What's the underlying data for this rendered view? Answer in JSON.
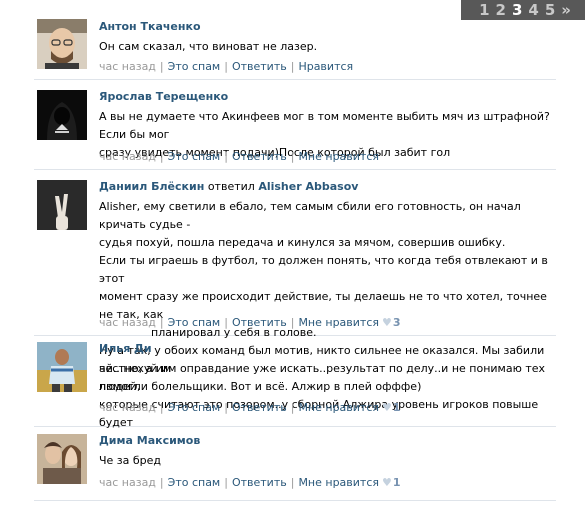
{
  "pager": {
    "pages": [
      "1",
      "2",
      "3",
      "4",
      "5"
    ],
    "current": "3",
    "next": "»"
  },
  "comments": [
    {
      "author": "Антон Ткаченко",
      "lines": [
        "Он сам сказал, что виноват не лазер."
      ],
      "time": "час назад",
      "spam": "Это спам",
      "reply": "Ответить",
      "like": "Нравится"
    },
    {
      "author": "Ярослав Терещенко",
      "lines": [
        "А вы не думаете что Акинфеев мог в том моменте выбить мяч из штрафной?Если бы мог",
        "сразу увидеть момент подачи)После которой был забит гол"
      ],
      "time": "час назад",
      "spam": "Это спам",
      "reply": "Ответить",
      "like": "Мне нравится"
    },
    {
      "author": "Даниил Блёскин",
      "reply_word": "ответил",
      "reply_to": "Alisher Abbasov",
      "lines": [
        "Alisher, ему светили в ебало, тем самым сбили его готовность, он начал кричать судье -",
        "судья похуй, пошла передача и кинулся за мячом, совершив ошибку.",
        "Если ты играешь в футбол, то должен понять, что когда тебя отвлекают и в этот",
        "момент сразу же происходит действие, ты делаешь не то что хотел, точнее не так, как",
        "планировал у себя в голове.",
        "Ну а так, у обоих команд был мотив, никто сильнее не оказался. Мы забили честно, а им",
        "помогли болельщики. Вот и всё. Алжир в плей офффе)"
      ],
      "time": "час назад",
      "spam": "Это спам",
      "reply": "Ответить",
      "like": "Мне нравится",
      "likes": "3"
    },
    {
      "author": "Илья Ди",
      "lines": [
        "ай...нехуй им оправдание уже искать..результат по делу..и не понимаю тех людей,",
        "которые считают это позором..у сборной Алжира уровень игроков повыше будет"
      ],
      "time": "час назад",
      "spam": "Это спам",
      "reply": "Ответить",
      "like": "Мне нравится",
      "likes": "1"
    },
    {
      "author": "Дима Максимов",
      "lines": [
        "Че за бред"
      ],
      "time": "час назад",
      "spam": "Это спам",
      "reply": "Ответить",
      "like": "Мне нравится",
      "likes": "1"
    }
  ],
  "colors": {
    "link": "#2b587a",
    "meta": "#999999",
    "pager_bg": "#585858",
    "divider": "#dfe4ea"
  },
  "icons": {
    "like": "heart-icon"
  }
}
